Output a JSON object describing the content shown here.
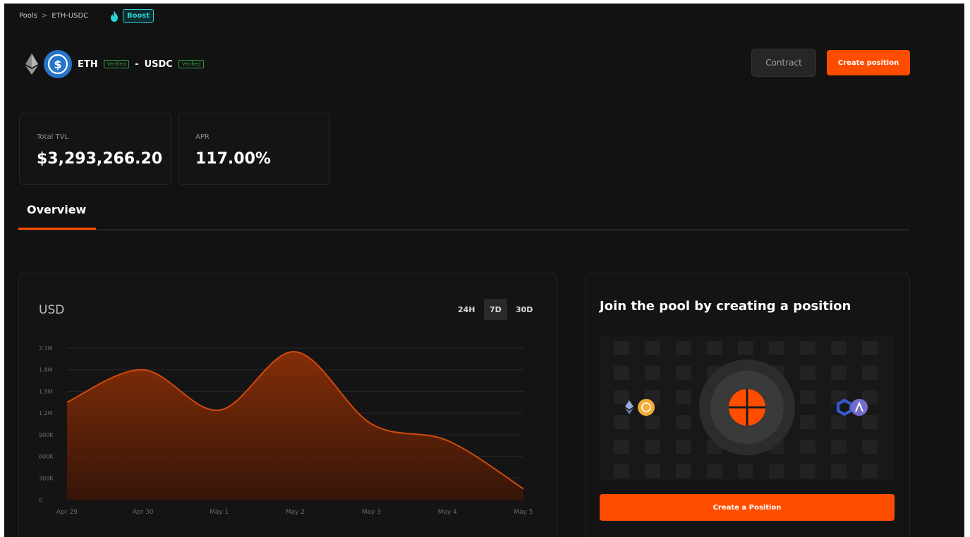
{
  "breadcrumb": {
    "root": "Pools",
    "separator": ">",
    "current": "ETH-USDC"
  },
  "boost": {
    "label": "Boost",
    "icon": "flame-icon"
  },
  "pair": {
    "token0": "ETH",
    "token0_badge": "Verified",
    "separator": "-",
    "token1": "USDC",
    "token1_badge": "Verified"
  },
  "actions": {
    "contract": "Contract",
    "create_position": "Create position"
  },
  "stats": [
    {
      "label": "Total TVL",
      "value": "$3,293,266.20"
    },
    {
      "label": "APR",
      "value": "117.00%"
    }
  ],
  "tabs": {
    "overview": "Overview"
  },
  "chart": {
    "title": "USD",
    "ranges": [
      "24H",
      "7D",
      "30D"
    ],
    "active_range": "7D"
  },
  "chart_data": {
    "type": "area",
    "title": "",
    "ylabel": "USD",
    "x": [
      "Apr 29",
      "Apr 30",
      "May 1",
      "May 2",
      "May 3",
      "May 4",
      "May 5"
    ],
    "y_ticks": [
      "0",
      "300K",
      "600K",
      "900K",
      "1.2M",
      "1.5M",
      "1.8M",
      "2.1M"
    ],
    "ylim": [
      0,
      2100000
    ],
    "series": [
      {
        "values": [
          1350000,
          1800000,
          1240000,
          2050000,
          1050000,
          820000,
          150000
        ]
      }
    ],
    "colors": {
      "line": "#d24a0c",
      "fill": "#a83a0a"
    },
    "grid": true
  },
  "join": {
    "title": "Join the pool by creating a position",
    "cta": "Create a Position"
  },
  "colors": {
    "accent": "#ff4d00",
    "boost": "#2ad3d8",
    "verified": "#2f9e44",
    "background": "#121212"
  }
}
